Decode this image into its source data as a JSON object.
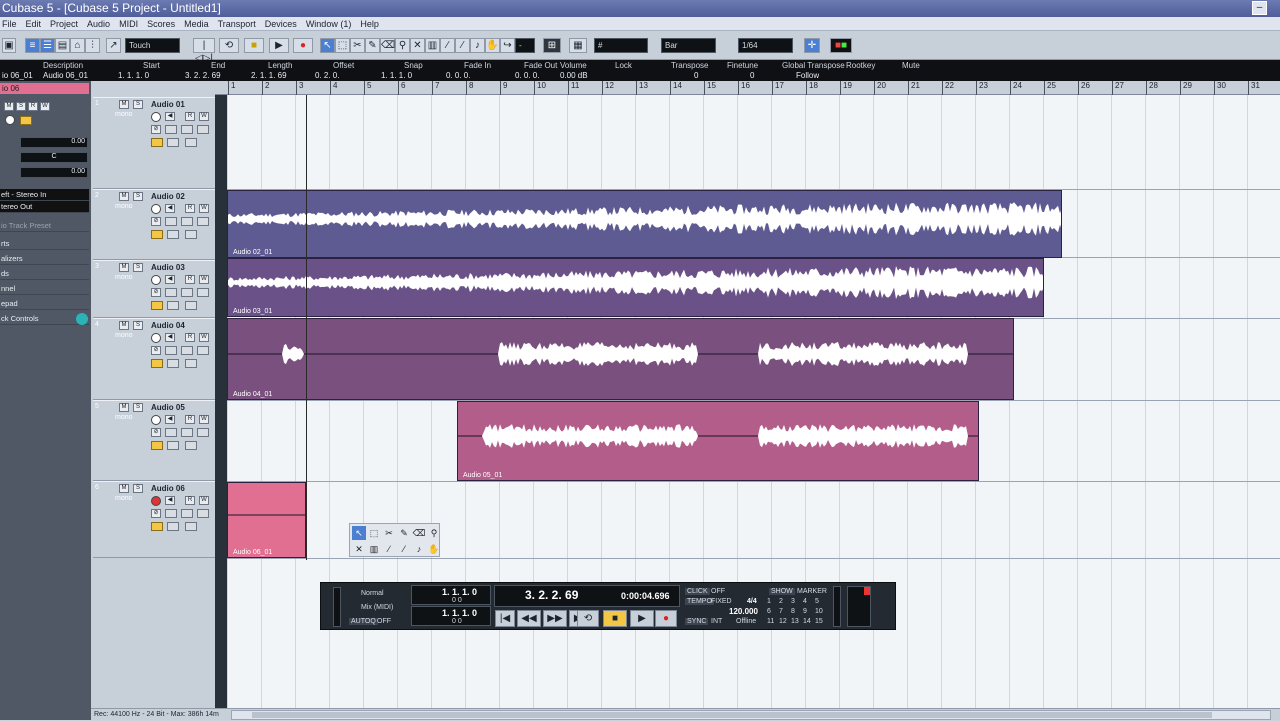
{
  "window": {
    "title": "Cubase 5 - [Cubase 5 Project - Untitled1]"
  },
  "menu": [
    "File",
    "Edit",
    "Project",
    "Audio",
    "MIDI",
    "Scores",
    "Media",
    "Transport",
    "Devices",
    "Window (1)",
    "Help"
  ],
  "toolbar": {
    "automation_mode": "Touch",
    "grid_type": "Bar",
    "quantize": "1/64",
    "nudge_value": "-"
  },
  "info_line": {
    "labels": [
      "Description",
      "Start",
      "End",
      "Length",
      "Offset",
      "Snap",
      "Fade In",
      "Fade Out",
      "Volume",
      "Lock",
      "Transpose",
      "Finetune",
      "Global Transpose",
      "Rootkey",
      "Mute"
    ],
    "values": [
      "Audio 06_01",
      "1. 1. 1. 0",
      "3. 2. 2. 69",
      "2. 1. 1. 69",
      "0. 2. 0.",
      "1. 1. 1. 0",
      "0. 0. 0.",
      "0. 0. 0.",
      "0.00 dB",
      "",
      "0",
      "0",
      "Follow",
      "",
      ""
    ],
    "left_cut": "io 06_01"
  },
  "inspector": {
    "track": "io 06",
    "vol_a": "0.00",
    "vol_b": "0.00",
    "pan": "C",
    "input": "eft - Stereo In",
    "output": "tereo Out",
    "preset": "io Track Preset",
    "sections": [
      "rts",
      "alizers",
      "ds",
      "nnel",
      "epad",
      "ck Controls"
    ]
  },
  "tracks": [
    {
      "num": "1",
      "name": "Audio 01",
      "mono": "mono"
    },
    {
      "num": "2",
      "name": "Audio 02",
      "mono": "mono"
    },
    {
      "num": "3",
      "name": "Audio 03",
      "mono": "mono"
    },
    {
      "num": "4",
      "name": "Audio 04",
      "mono": "mono"
    },
    {
      "num": "5",
      "name": "Audio 05",
      "mono": "mono"
    },
    {
      "num": "6",
      "name": "Audio 06",
      "mono": "mono"
    }
  ],
  "ruler": [
    "1",
    "2",
    "3",
    "4",
    "5",
    "6",
    "7",
    "8",
    "9",
    "10",
    "11",
    "12",
    "13",
    "14",
    "15",
    "16",
    "17",
    "18",
    "19",
    "20",
    "21",
    "22",
    "23",
    "24",
    "25",
    "26",
    "27",
    "28",
    "29",
    "30",
    "31"
  ],
  "events": {
    "e2": "Audio 02_01",
    "e3": "Audio 03_01",
    "e4": "Audio 04_01",
    "e5": "Audio 05_01",
    "e6": "Audio 06_01"
  },
  "colors": {
    "e2": "#5e5a92",
    "e3": "#6a5289",
    "e4": "#7a517e",
    "e5": "#b25d8a",
    "e6": "#e06f92"
  },
  "transport": {
    "mode_a": "Normal",
    "mode_b": "Mix (MIDI)",
    "autoq": "AUTOQ",
    "autoq_val": "OFF",
    "left_loc": "1. 1. 1. 0",
    "right_loc": "1. 1. 1. 0",
    "left_small": "0     0",
    "right_small": "0     0",
    "position": "3. 2. 2. 69",
    "time": "0:00:04.696",
    "click": "CLICK",
    "click_val": "OFF",
    "tempo": "TEMPO",
    "tempo_mode": "FIXED",
    "signature": "4/4",
    "tempo_val": "120.000",
    "sync": "SYNC",
    "sync_mode": "INT",
    "sync_val": "Offline",
    "show": "SHOW",
    "marker": "MARKER",
    "markers": [
      "1",
      "2",
      "3",
      "4",
      "5",
      "6",
      "7",
      "8",
      "9",
      "10",
      "11",
      "12",
      "13",
      "14",
      "15"
    ]
  },
  "status": {
    "rec": "Rec: 44100 Hz - 24 Bit - Max: 386h 14m"
  }
}
